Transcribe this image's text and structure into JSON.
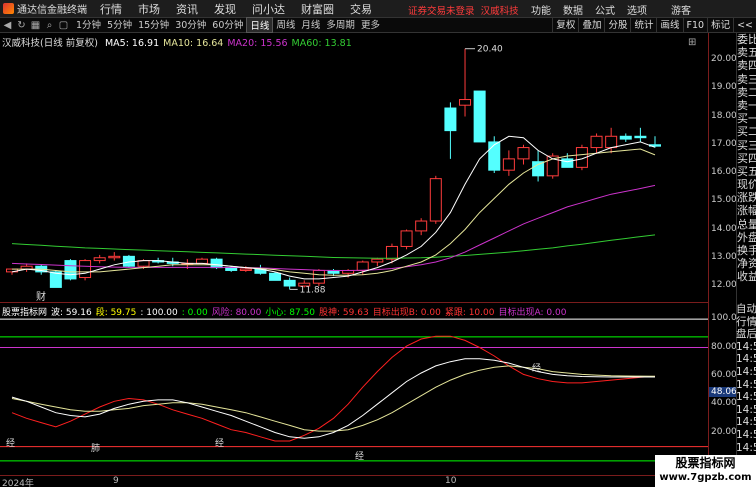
{
  "topbar": {
    "app_name": "通达信金融终端",
    "menu": [
      "行情",
      "市场",
      "资讯",
      "发现",
      "问小达",
      "财富圈",
      "交易"
    ],
    "notice": "证券交易未登录",
    "stock": "汉威科技",
    "right": [
      "功能",
      "数据",
      "公式",
      "选项",
      "",
      "游客"
    ]
  },
  "toolbar": {
    "periods": [
      "1分钟",
      "5分钟",
      "15分钟",
      "30分钟",
      "60分钟",
      "日线",
      "周线",
      "月线",
      "多周期",
      "更多"
    ],
    "active_period": "日线",
    "right_tools": [
      "复权",
      "叠加",
      "分股",
      "统计",
      "画线",
      "F10",
      "标记",
      "<<"
    ]
  },
  "ma_legend": {
    "title": "汉威科技(日线 前复权)",
    "items": [
      {
        "label": "MA5: 16.91",
        "color": "#ffffff"
      },
      {
        "label": "MA10: 16.64",
        "color": "#e5e59a"
      },
      {
        "label": "MA20: 15.56",
        "color": "#cc33cc"
      },
      {
        "label": "MA60: 13.81",
        "color": "#33cc33"
      }
    ]
  },
  "main_axis": [
    "20.00",
    "19.00",
    "18.00",
    "17.00",
    "16.00",
    "15.00",
    "14.00",
    "13.00",
    "12.00"
  ],
  "price_annotations": {
    "high": "20.40",
    "low": "11.88",
    "marker": "财"
  },
  "indicator_legend": {
    "items": [
      {
        "label": "股票指标网",
        "color": "#ffffff"
      },
      {
        "label": "波: 59.16",
        "color": "#ffffff"
      },
      {
        "label": "段: 59.75",
        "color": "#ffff00"
      },
      {
        "label": ": 100.00",
        "color": "#ffffff"
      },
      {
        "label": ": 0.00",
        "color": "#00ff00"
      },
      {
        "label": "风险: 80.00",
        "color": "#cc33cc"
      },
      {
        "label": "小心: 87.50",
        "color": "#00ff00"
      },
      {
        "label": "股神: 59.63",
        "color": "#ff3333"
      },
      {
        "label": "目标出现B: 0.00",
        "color": "#ff3333"
      },
      {
        "label": "紧跟: 10.00",
        "color": "#ff3333"
      },
      {
        "label": "目标出现A: 0.00",
        "color": "#cc33cc"
      }
    ]
  },
  "ind_axis": [
    "100.00",
    "80.00",
    "60.00",
    "40.00",
    "20.00"
  ],
  "ind_current": "48.06",
  "wave_labels": [
    "经",
    "肺",
    "经",
    "经",
    "经"
  ],
  "xaxis": [
    "2024年",
    "9",
    "10"
  ],
  "side_labels": [
    "委比",
    "卖五",
    "卖四",
    "卖三",
    "卖二",
    "卖一",
    "买一",
    "买二",
    "买三",
    "买四",
    "买五",
    "现价",
    "涨跌",
    "涨幅",
    "总量",
    "外盘",
    "换手",
    "净资",
    "收益"
  ],
  "side_labels2": [
    "自动",
    "行情",
    "盘后",
    "14:50",
    "14:50",
    "14:50",
    "14:50",
    "14:50",
    "14:50",
    "14:50",
    "14:50",
    "14:50",
    "14:50",
    "14:50"
  ],
  "watermark": {
    "line1": "股票指标网",
    "line2": "www.7gpzb.com"
  },
  "chart_data": {
    "type": "candlestick",
    "candles": [
      [
        12.5,
        12.6,
        12.4,
        12.6
      ],
      [
        12.6,
        12.8,
        12.5,
        12.7
      ],
      [
        12.7,
        12.75,
        12.4,
        12.5
      ],
      [
        12.5,
        12.55,
        11.95,
        11.95
      ],
      [
        12.9,
        12.95,
        12.2,
        12.25
      ],
      [
        12.3,
        12.95,
        12.2,
        12.9
      ],
      [
        12.9,
        13.1,
        12.8,
        13.0
      ],
      [
        13.0,
        13.2,
        12.9,
        13.05
      ],
      [
        13.05,
        13.1,
        12.65,
        12.7
      ],
      [
        12.7,
        12.95,
        12.6,
        12.9
      ],
      [
        12.9,
        13.0,
        12.8,
        12.85
      ],
      [
        12.85,
        13.0,
        12.7,
        12.8
      ],
      [
        12.8,
        12.95,
        12.6,
        12.8
      ],
      [
        12.8,
        13.0,
        12.8,
        12.95
      ],
      [
        12.95,
        13.0,
        12.6,
        12.65
      ],
      [
        12.65,
        12.7,
        12.5,
        12.55
      ],
      [
        12.55,
        12.7,
        12.5,
        12.6
      ],
      [
        12.6,
        12.75,
        12.4,
        12.45
      ],
      [
        12.45,
        12.5,
        12.2,
        12.2
      ],
      [
        12.2,
        12.3,
        11.88,
        12.0
      ],
      [
        12.0,
        12.2,
        11.95,
        12.1
      ],
      [
        12.1,
        12.6,
        12.0,
        12.55
      ],
      [
        12.55,
        12.6,
        12.35,
        12.45
      ],
      [
        12.45,
        12.6,
        12.3,
        12.55
      ],
      [
        12.55,
        12.9,
        12.4,
        12.85
      ],
      [
        12.85,
        13.0,
        12.7,
        12.95
      ],
      [
        12.95,
        13.5,
        12.8,
        13.4
      ],
      [
        13.4,
        14.0,
        13.3,
        13.95
      ],
      [
        13.95,
        14.4,
        13.8,
        14.3
      ],
      [
        14.3,
        15.9,
        14.2,
        15.8
      ],
      [
        18.3,
        18.5,
        16.5,
        17.5
      ],
      [
        18.4,
        20.4,
        18.0,
        18.6
      ],
      [
        18.9,
        18.9,
        17.3,
        17.1
      ],
      [
        17.1,
        17.3,
        16.0,
        16.1
      ],
      [
        16.1,
        16.8,
        15.9,
        16.5
      ],
      [
        16.5,
        17.0,
        16.3,
        16.9
      ],
      [
        16.4,
        16.8,
        15.7,
        15.9
      ],
      [
        15.9,
        16.7,
        15.8,
        16.6
      ],
      [
        16.5,
        16.7,
        16.2,
        16.2
      ],
      [
        16.2,
        17.0,
        16.1,
        16.9
      ],
      [
        16.9,
        17.4,
        16.7,
        17.3
      ],
      [
        16.9,
        17.6,
        16.7,
        17.3
      ],
      [
        17.3,
        17.4,
        17.1,
        17.2
      ],
      [
        17.3,
        17.6,
        17.1,
        17.25
      ],
      [
        17.0,
        17.3,
        16.9,
        16.95
      ]
    ],
    "ma5": [
      12.5,
      12.6,
      12.55,
      12.45,
      12.4,
      12.45,
      12.6,
      12.75,
      12.85,
      12.9,
      12.9,
      12.85,
      12.8,
      12.8,
      12.75,
      12.7,
      12.65,
      12.6,
      12.5,
      12.35,
      12.25,
      12.25,
      12.3,
      12.35,
      12.5,
      12.65,
      12.85,
      13.1,
      13.4,
      13.9,
      14.6,
      15.6,
      16.5,
      17.0,
      17.3,
      17.25,
      16.8,
      16.5,
      16.4,
      16.5,
      16.7,
      16.9,
      17.0,
      17.1,
      16.91
    ],
    "ma10": [
      12.6,
      12.6,
      12.6,
      12.55,
      12.5,
      12.5,
      12.5,
      12.55,
      12.6,
      12.65,
      12.7,
      12.75,
      12.75,
      12.75,
      12.75,
      12.7,
      12.65,
      12.62,
      12.58,
      12.5,
      12.45,
      12.4,
      12.38,
      12.38,
      12.4,
      12.45,
      12.55,
      12.7,
      12.85,
      13.1,
      13.5,
      14.0,
      14.6,
      15.1,
      15.6,
      16.0,
      16.3,
      16.5,
      16.6,
      16.65,
      16.7,
      16.75,
      16.8,
      16.85,
      16.64
    ],
    "ma20": [
      12.8,
      12.78,
      12.76,
      12.74,
      12.72,
      12.7,
      12.68,
      12.67,
      12.66,
      12.66,
      12.66,
      12.66,
      12.66,
      12.66,
      12.66,
      12.66,
      12.65,
      12.64,
      12.62,
      12.6,
      12.58,
      12.56,
      12.55,
      12.55,
      12.56,
      12.58,
      12.62,
      12.68,
      12.75,
      12.85,
      13.0,
      13.2,
      13.45,
      13.7,
      13.95,
      14.2,
      14.4,
      14.6,
      14.8,
      14.95,
      15.1,
      15.25,
      15.35,
      15.45,
      15.56
    ],
    "ma60": [
      13.5,
      13.47,
      13.44,
      13.41,
      13.38,
      13.35,
      13.33,
      13.31,
      13.29,
      13.27,
      13.25,
      13.23,
      13.21,
      13.19,
      13.17,
      13.15,
      13.13,
      13.11,
      13.09,
      13.07,
      13.05,
      13.03,
      13.01,
      13.0,
      12.99,
      12.98,
      12.98,
      12.99,
      13.0,
      13.02,
      13.05,
      13.08,
      13.12,
      13.16,
      13.2,
      13.25,
      13.3,
      13.35,
      13.42,
      13.48,
      13.55,
      13.62,
      13.68,
      13.75,
      13.81
    ],
    "bo": [
      45,
      42,
      38,
      34,
      32,
      31,
      33,
      37,
      40,
      42,
      43,
      43,
      41,
      38,
      35,
      32,
      28,
      24,
      20,
      17,
      16,
      17,
      20,
      25,
      32,
      40,
      48,
      56,
      62,
      67,
      70,
      72,
      72,
      71,
      69,
      66,
      63,
      61,
      60,
      59.5,
      59.3,
      59.2,
      59.2,
      59.2,
      59.16
    ],
    "duan": [
      44,
      42,
      40,
      38,
      36,
      35,
      35,
      36,
      37,
      39,
      40,
      41,
      41,
      40,
      38,
      36,
      34,
      31,
      28,
      25,
      22,
      21,
      21,
      22,
      25,
      29,
      34,
      40,
      46,
      52,
      57,
      61,
      64,
      66,
      67,
      66,
      65,
      63,
      62,
      61,
      60.5,
      60,
      59.9,
      59.8,
      59.75
    ],
    "gushen": [
      34,
      30,
      27,
      24,
      28,
      33,
      38,
      42,
      44,
      43,
      40,
      36,
      33,
      30,
      26,
      22,
      20,
      17,
      14,
      14,
      18,
      23,
      30,
      40,
      52,
      63,
      73,
      81,
      86,
      88,
      88,
      85,
      80,
      74,
      67,
      61,
      58,
      56,
      55,
      55,
      56,
      57,
      58,
      59,
      59.63
    ],
    "h_lines": [
      100,
      87.5,
      80,
      10,
      0
    ]
  }
}
